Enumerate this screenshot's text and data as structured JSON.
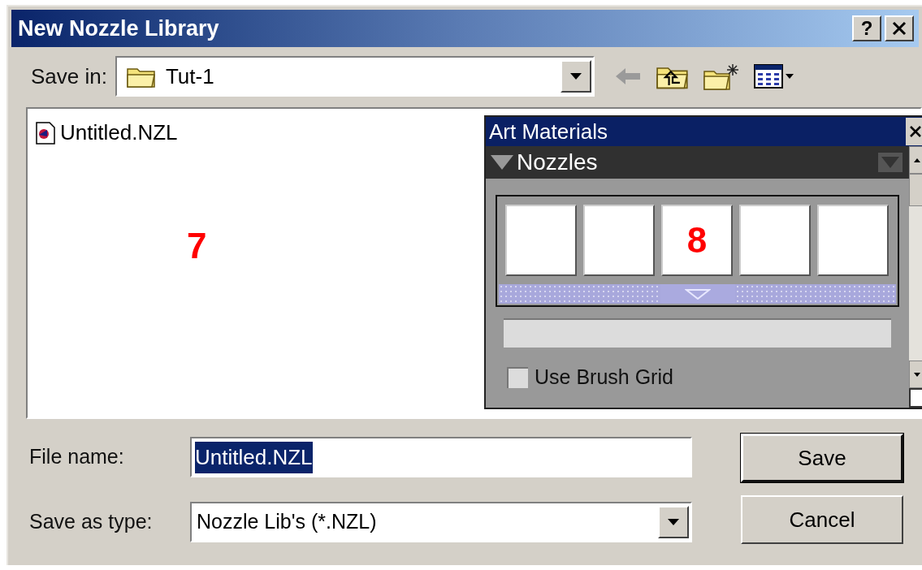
{
  "window": {
    "title": "New Nozzle Library",
    "help_button": "?"
  },
  "save_in": {
    "label": "Save in:",
    "folder": "Tut-1"
  },
  "file_list": {
    "files": [
      {
        "name": "Untitled.NZL",
        "selected": false
      }
    ],
    "annotation": "7"
  },
  "palette": {
    "title": "Art Materials",
    "section": "Nozzles",
    "expanded": true,
    "cells": [
      {},
      {},
      {
        "annotation": "8"
      },
      {},
      {}
    ],
    "checkbox": {
      "label": "Use Brush Grid",
      "checked": false
    }
  },
  "file_name": {
    "label": "File name:",
    "value": "Untitled.NZL",
    "selected": true
  },
  "save_as_type": {
    "label": "Save as type:",
    "value": "Nozzle Lib's (*.NZL)"
  },
  "buttons": [
    {
      "label": "Save",
      "default": true
    },
    {
      "label": "Cancel",
      "default": false
    }
  ]
}
